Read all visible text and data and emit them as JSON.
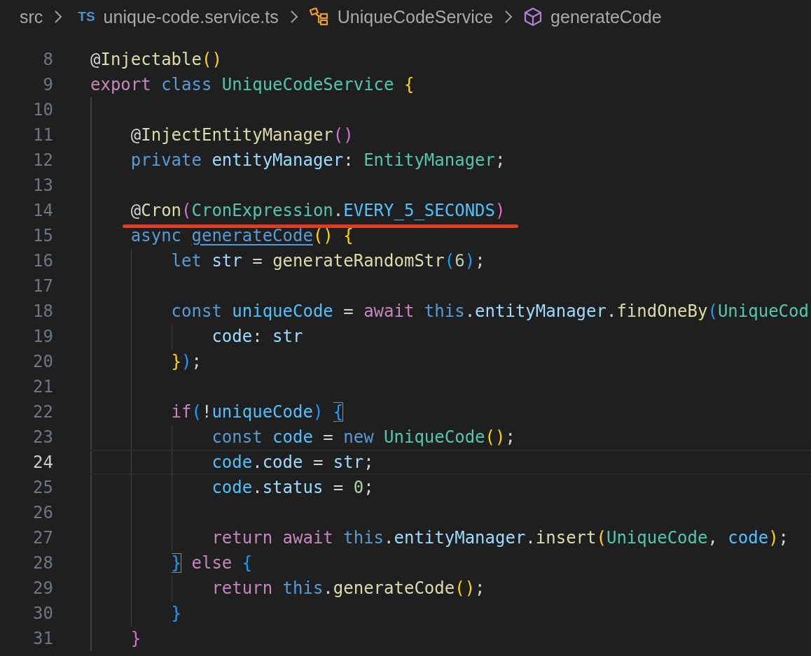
{
  "breadcrumb": [
    {
      "kind": "folder",
      "label": "src"
    },
    {
      "kind": "file",
      "badge": "TS",
      "label": "unique-code.service.ts"
    },
    {
      "kind": "class",
      "label": "UniqueCodeService"
    },
    {
      "kind": "method",
      "label": "generateCode"
    }
  ],
  "lines": [
    {
      "number": "8",
      "current": false,
      "underlined": false,
      "tokens": [
        {
          "kind": "deco",
          "text": "@"
        },
        {
          "kind": "fn",
          "text": "Injectable"
        },
        {
          "kind": "br1",
          "text": "()"
        }
      ]
    },
    {
      "number": "9",
      "current": false,
      "underlined": false,
      "tokens": [
        {
          "kind": "ctrl",
          "text": "export"
        },
        {
          "kind": "kw",
          "text": " class"
        },
        {
          "kind": "type",
          "text": " UniqueCodeService"
        },
        {
          "kind": "br1",
          "text": " {"
        }
      ]
    },
    {
      "number": "10",
      "current": false,
      "underlined": false
    },
    {
      "number": "11",
      "current": false,
      "underlined": false,
      "tokens": [
        {
          "kind": "deco",
          "text": "    @"
        },
        {
          "kind": "fn",
          "text": "InjectEntityManager"
        },
        {
          "kind": "br2",
          "text": "()"
        }
      ]
    },
    {
      "number": "12",
      "current": false,
      "underlined": false,
      "tokens": [
        {
          "kind": "kw",
          "text": "    private"
        },
        {
          "kind": "var",
          "text": " entityManager"
        },
        {
          "kind": "punct",
          "text": ": "
        },
        {
          "kind": "type",
          "text": "EntityManager"
        },
        {
          "kind": "punct",
          "text": ";"
        }
      ]
    },
    {
      "number": "13",
      "current": false,
      "underlined": false
    },
    {
      "number": "14",
      "current": false,
      "underlined": true,
      "tokens": [
        {
          "kind": "deco",
          "text": "    @"
        },
        {
          "kind": "fn",
          "text": "Cron"
        },
        {
          "kind": "br2",
          "text": "("
        },
        {
          "kind": "type",
          "text": "CronExpression"
        },
        {
          "kind": "punct",
          "text": "."
        },
        {
          "kind": "const",
          "text": "EVERY_5_SECONDS"
        },
        {
          "kind": "br2",
          "text": ")"
        }
      ]
    },
    {
      "number": "15",
      "current": false,
      "underlined": false,
      "tokens": [
        {
          "kind": "kw",
          "text": "    async"
        },
        {
          "kind": "link",
          "text": " generateCode"
        },
        {
          "kind": "br1",
          "text": "()"
        },
        {
          "kind": "br1",
          "text": " {"
        }
      ]
    },
    {
      "number": "16",
      "current": false,
      "underlined": false,
      "tokens": [
        {
          "kind": "kw",
          "text": "        let"
        },
        {
          "kind": "var",
          "text": " str"
        },
        {
          "kind": "punct",
          "text": " = "
        },
        {
          "kind": "fn",
          "text": "generateRandomStr"
        },
        {
          "kind": "br3",
          "text": "("
        },
        {
          "kind": "num",
          "text": "6"
        },
        {
          "kind": "br3",
          "text": ")"
        },
        {
          "kind": "punct",
          "text": ";"
        }
      ]
    },
    {
      "number": "17",
      "current": false,
      "underlined": false
    },
    {
      "number": "18",
      "current": false,
      "underlined": false,
      "tokens": [
        {
          "kind": "kw",
          "text": "        const"
        },
        {
          "kind": "const",
          "text": " uniqueCode"
        },
        {
          "kind": "punct",
          "text": " = "
        },
        {
          "kind": "ctrl",
          "text": "await"
        },
        {
          "kind": "kw",
          "text": " this"
        },
        {
          "kind": "punct",
          "text": "."
        },
        {
          "kind": "var",
          "text": "entityManager"
        },
        {
          "kind": "punct",
          "text": "."
        },
        {
          "kind": "fn",
          "text": "findOneBy"
        },
        {
          "kind": "br3",
          "text": "("
        },
        {
          "kind": "type",
          "text": "UniqueCod"
        }
      ]
    },
    {
      "number": "19",
      "current": false,
      "underlined": false,
      "tokens": [
        {
          "kind": "var",
          "text": "            code"
        },
        {
          "kind": "punct",
          "text": ": "
        },
        {
          "kind": "var",
          "text": "str"
        }
      ]
    },
    {
      "number": "20",
      "current": false,
      "underlined": false,
      "tokens": [
        {
          "kind": "br1",
          "text": "        }"
        },
        {
          "kind": "br3",
          "text": ")"
        },
        {
          "kind": "punct",
          "text": ";"
        }
      ]
    },
    {
      "number": "21",
      "current": false,
      "underlined": false
    },
    {
      "number": "22",
      "current": false,
      "underlined": false,
      "tokens": [
        {
          "kind": "ctrl",
          "text": "        if"
        },
        {
          "kind": "br3",
          "text": "("
        },
        {
          "kind": "punct",
          "text": "!"
        },
        {
          "kind": "const",
          "text": "uniqueCode"
        },
        {
          "kind": "br3",
          "text": ")"
        },
        {
          "kind": "match",
          "text": " {"
        }
      ]
    },
    {
      "number": "23",
      "current": false,
      "underlined": false,
      "tokens": [
        {
          "kind": "kw",
          "text": "            const"
        },
        {
          "kind": "const",
          "text": " code"
        },
        {
          "kind": "punct",
          "text": " = "
        },
        {
          "kind": "kw",
          "text": "new"
        },
        {
          "kind": "type",
          "text": " UniqueCode"
        },
        {
          "kind": "br1",
          "text": "()"
        },
        {
          "kind": "punct",
          "text": ";"
        }
      ]
    },
    {
      "number": "24",
      "current": true,
      "underlined": false,
      "tokens": [
        {
          "kind": "const",
          "text": "            code"
        },
        {
          "kind": "punct",
          "text": "."
        },
        {
          "kind": "var",
          "text": "code"
        },
        {
          "kind": "punct",
          "text": " = "
        },
        {
          "kind": "var",
          "text": "str"
        },
        {
          "kind": "punct",
          "text": ";"
        }
      ]
    },
    {
      "number": "25",
      "current": false,
      "underlined": false,
      "tokens": [
        {
          "kind": "const",
          "text": "            code"
        },
        {
          "kind": "punct",
          "text": "."
        },
        {
          "kind": "var",
          "text": "status"
        },
        {
          "kind": "punct",
          "text": " = "
        },
        {
          "kind": "num",
          "text": "0"
        },
        {
          "kind": "punct",
          "text": ";"
        }
      ]
    },
    {
      "number": "26",
      "current": false,
      "underlined": false
    },
    {
      "number": "27",
      "current": false,
      "underlined": false,
      "tokens": [
        {
          "kind": "ctrl",
          "text": "            return"
        },
        {
          "kind": "ctrl",
          "text": " await"
        },
        {
          "kind": "kw",
          "text": " this"
        },
        {
          "kind": "punct",
          "text": "."
        },
        {
          "kind": "var",
          "text": "entityManager"
        },
        {
          "kind": "punct",
          "text": "."
        },
        {
          "kind": "fn",
          "text": "insert"
        },
        {
          "kind": "br1",
          "text": "("
        },
        {
          "kind": "type",
          "text": "UniqueCode"
        },
        {
          "kind": "punct",
          "text": ", "
        },
        {
          "kind": "const",
          "text": "code"
        },
        {
          "kind": "br1",
          "text": ")"
        },
        {
          "kind": "punct",
          "text": ";"
        }
      ]
    },
    {
      "number": "28",
      "current": false,
      "underlined": false,
      "tokens": [
        {
          "kind": "match",
          "text": "        }"
        },
        {
          "kind": "ctrl",
          "text": " else"
        },
        {
          "kind": "br3",
          "text": " {"
        }
      ]
    },
    {
      "number": "29",
      "current": false,
      "underlined": false,
      "tokens": [
        {
          "kind": "ctrl",
          "text": "            return"
        },
        {
          "kind": "kw",
          "text": " this"
        },
        {
          "kind": "punct",
          "text": "."
        },
        {
          "kind": "fn",
          "text": "generateCode"
        },
        {
          "kind": "br1",
          "text": "()"
        },
        {
          "kind": "punct",
          "text": ";"
        }
      ]
    },
    {
      "number": "30",
      "current": false,
      "underlined": false,
      "tokens": [
        {
          "kind": "br3",
          "text": "        }"
        }
      ]
    },
    {
      "number": "31",
      "current": false,
      "underlined": false,
      "tokens": [
        {
          "kind": "br2",
          "text": "    }"
        }
      ]
    }
  ]
}
